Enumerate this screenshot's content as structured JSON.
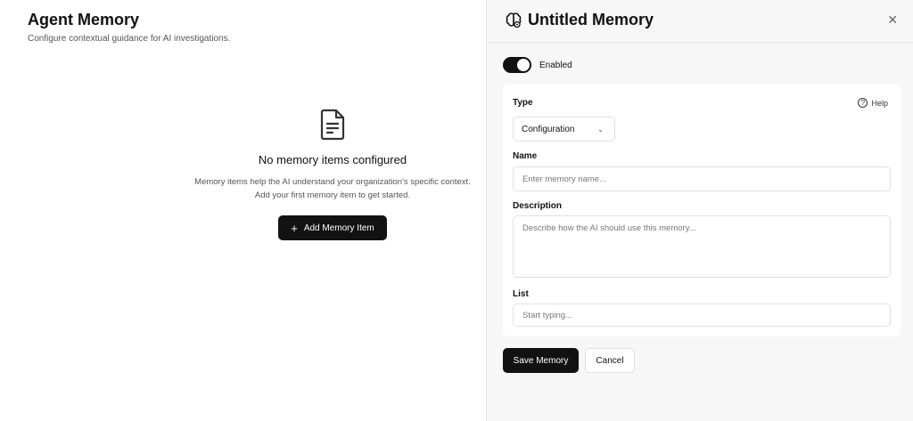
{
  "main": {
    "title": "Agent Memory",
    "subtitle": "Configure contextual guidance for AI investigations.",
    "empty_state": {
      "icon": "document-icon",
      "title": "No memory items configured",
      "description": "Memory items help the AI understand your organization's specific context. Add your first memory item to get started.",
      "button_label": "Add Memory Item"
    }
  },
  "panel": {
    "title": "Untitled Memory",
    "title_icon": "brain-icon",
    "close_icon": "close-icon",
    "toggle": {
      "label": "Enabled",
      "on": true
    },
    "type": {
      "label": "Type",
      "value": "Configuration",
      "help_label": "Help"
    },
    "name": {
      "label": "Name",
      "placeholder": "Enter memory name..."
    },
    "description": {
      "label": "Description",
      "placeholder": "Describe how the AI should use this memory..."
    },
    "list": {
      "label": "List",
      "placeholder": "Start typing..."
    },
    "save_label": "Save Memory",
    "cancel_label": "Cancel"
  },
  "colors": {
    "primary_button": "#121212",
    "panel_background": "#f7f7f7"
  }
}
